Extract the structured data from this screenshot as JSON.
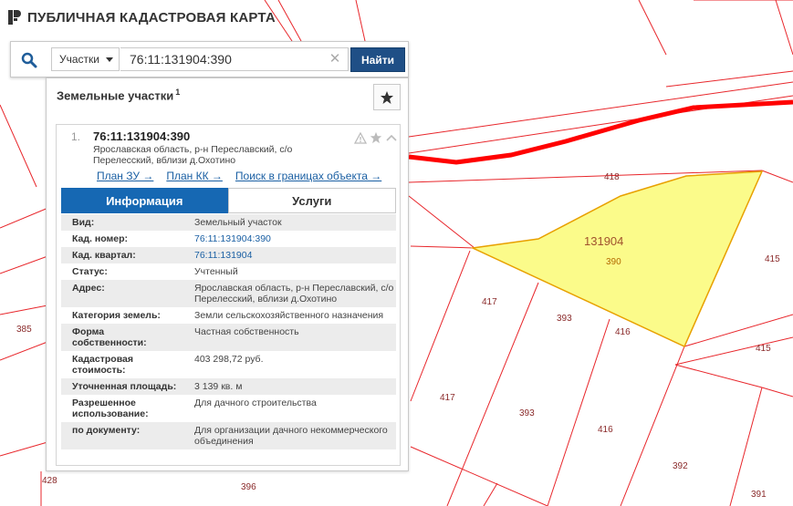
{
  "header": {
    "title": "ПУБЛИЧНАЯ КАДАСТРОВАЯ КАРТА",
    "logo_icon": "pkk-logo-icon"
  },
  "search": {
    "type_label": "Участки",
    "query": "76:11:131904:390",
    "find_label": "Найти"
  },
  "results": {
    "title": "Земельные участки",
    "count": "1"
  },
  "card": {
    "number": "1.",
    "cad_num": "76:11:131904:390",
    "address": "Ярославская область, р-н Переславский, с/о Перелесский, вблизи д.Охотино",
    "links": [
      "План ЗУ →",
      "План КК →",
      "Поиск в границах объекта →"
    ],
    "tabs": [
      "Информация",
      "Услуги"
    ],
    "attributes": [
      {
        "key": "Вид:",
        "value": "Земельный участок",
        "link": false
      },
      {
        "key": "Кад. номер:",
        "value": "76:11:131904:390",
        "link": true
      },
      {
        "key": "Кад. квартал:",
        "value": "76:11:131904",
        "link": true
      },
      {
        "key": "Статус:",
        "value": "Учтенный",
        "link": false
      },
      {
        "key": "Адрес:",
        "value": "Ярославская область, р-н Переславский, с/о Перелесский, вблизи д.Охотино",
        "link": false
      },
      {
        "key": "Категория земель:",
        "value": "Земли сельскохозяйственного назначения",
        "link": false
      },
      {
        "key": "Форма собственности:",
        "value": "Частная собственность",
        "link": false
      },
      {
        "key": "Кадастровая стоимость:",
        "value": "403 298,72 руб.",
        "link": false
      },
      {
        "key": "Уточненная площадь:",
        "value": "3 139 кв. м",
        "link": false
      },
      {
        "key": "Разрешенное использование:",
        "value": "Для дачного строительства",
        "link": false
      },
      {
        "key": "по документу:",
        "value": "Для организации дачного некоммерческого объединения",
        "link": false
      }
    ]
  },
  "map": {
    "labels": [
      "418",
      "131904",
      "390",
      "415",
      "417",
      "393",
      "416",
      "415",
      "417",
      "393",
      "416",
      "392",
      "391",
      "396",
      "428",
      "385"
    ],
    "highlight_color": "#fbfb8a",
    "boundary_color": "#e8262b",
    "region_boundary_color": "#ff0000"
  }
}
